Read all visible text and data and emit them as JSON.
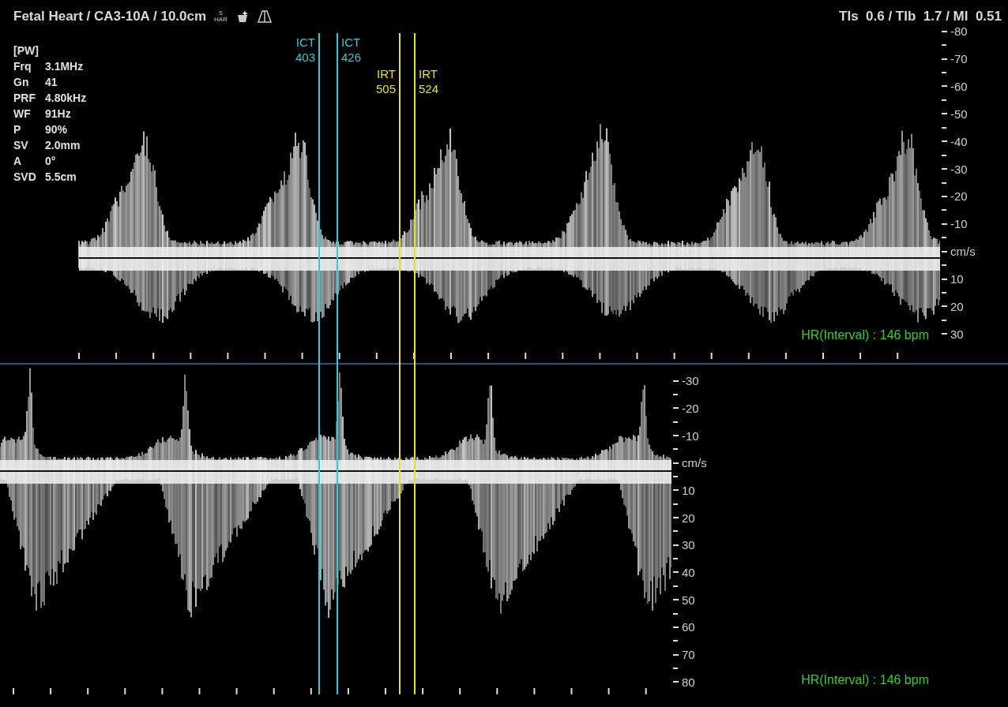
{
  "header": {
    "title": "Fetal Heart / CA3-10A / 10.0cm",
    "har_top": "S",
    "har_bottom": "HAR",
    "indices": "TIs  0.6 / TIb  1.7 / MI  0.51"
  },
  "params": {
    "mode": "[PW]",
    "rows": [
      {
        "label": "Frq",
        "value": "3.1MHz"
      },
      {
        "label": "Gn",
        "value": "41"
      },
      {
        "label": "PRF",
        "value": "4.80kHz"
      },
      {
        "label": "WF",
        "value": "91Hz"
      },
      {
        "label": "P",
        "value": "90%"
      },
      {
        "label": "SV",
        "value": "2.0mm"
      },
      {
        "label": "A",
        "value": "0°"
      },
      {
        "label": "SVD",
        "value": "5.5cm"
      }
    ]
  },
  "calipers": [
    {
      "label": "ICT",
      "value": "403",
      "color": "#33c9d6"
    },
    {
      "label": "ICT",
      "value": "426",
      "color": "#33c9d6"
    },
    {
      "label": "IRT",
      "value": "505",
      "color": "#e6e033"
    },
    {
      "label": "IRT",
      "value": "524",
      "color": "#e6e033"
    }
  ],
  "top_trace": {
    "scale": [
      "-80",
      "-70",
      "-60",
      "-50",
      "-40",
      "-30",
      "-20",
      "-10",
      "cm/s",
      "10",
      "20",
      "30"
    ],
    "heart_rate": "HR(Interval) : 146 bpm"
  },
  "bottom_trace": {
    "scale": [
      "-30",
      "-20",
      "-10",
      "cm/s",
      "10",
      "20",
      "30",
      "40",
      "50",
      "60",
      "70",
      "80"
    ],
    "heart_rate": "HR(Interval) : 146 bpm"
  }
}
